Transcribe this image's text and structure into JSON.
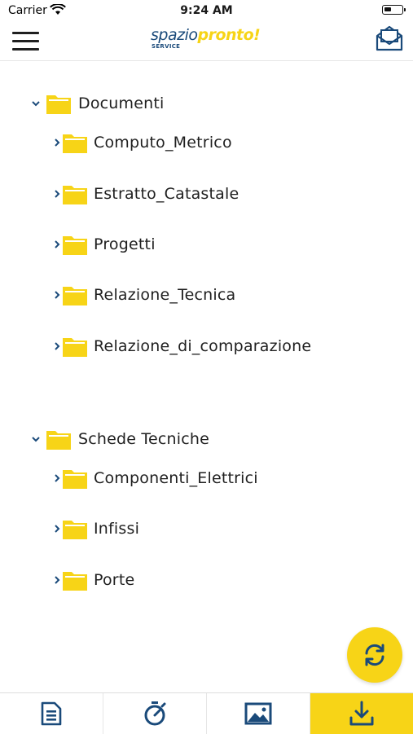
{
  "status": {
    "carrier": "Carrier",
    "time": "9:24 AM"
  },
  "header": {
    "logo_part1": "spazio",
    "logo_part2": "pronto!",
    "logo_sub": "SERVICE"
  },
  "tree": {
    "groups": [
      {
        "label": "Documenti",
        "children": [
          {
            "label": "Computo_Metrico"
          },
          {
            "label": "Estratto_Catastale"
          },
          {
            "label": "Progetti"
          },
          {
            "label": "Relazione_Tecnica"
          },
          {
            "label": "Relazione_di_comparazione"
          }
        ]
      },
      {
        "label": "Schede Tecniche",
        "children": [
          {
            "label": "Componenti_Elettrici"
          },
          {
            "label": "Infissi"
          },
          {
            "label": "Porte"
          }
        ]
      }
    ]
  },
  "tabs": [
    {
      "icon": "document-icon",
      "active": false
    },
    {
      "icon": "stopwatch-icon",
      "active": false
    },
    {
      "icon": "image-icon",
      "active": false
    },
    {
      "icon": "download-icon",
      "active": true
    }
  ],
  "colors": {
    "accent": "#f7d417",
    "icon": "#1a4a7a",
    "folder": "#f7d417"
  }
}
